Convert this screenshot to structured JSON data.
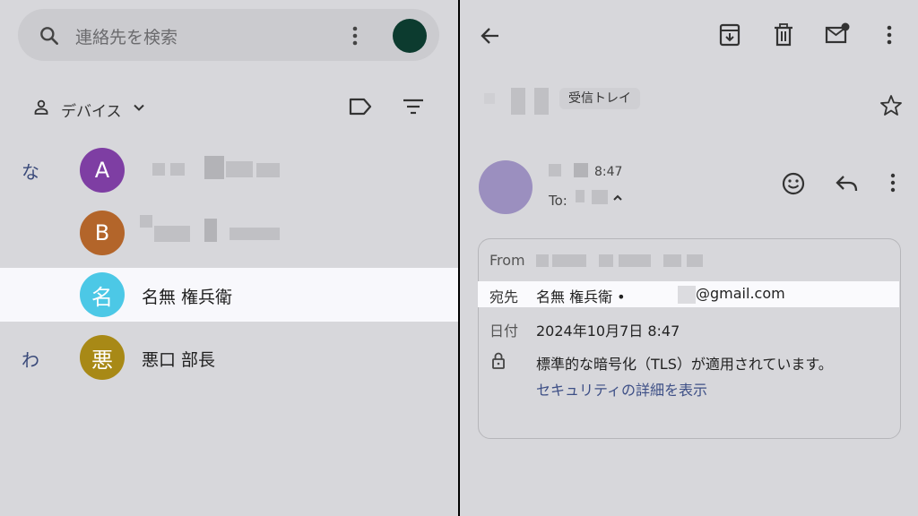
{
  "contacts_app": {
    "search_placeholder": "連絡先を検索",
    "filter_label": "デバイス",
    "sections": [
      {
        "letter": "な"
      },
      {
        "letter": "わ"
      }
    ],
    "contacts": [
      {
        "initial": "A",
        "color": "#7e3ea3"
      },
      {
        "initial": "B",
        "color": "#b3652a"
      },
      {
        "initial": "名",
        "name": "名無 権兵衛",
        "color": "#4cc8e6",
        "selected": true
      },
      {
        "initial": "悪",
        "name": "悪口 部長",
        "color": "#a88916"
      }
    ],
    "account_avatar_color": "#0c3b2f",
    "icons": [
      "search-icon",
      "more-vert-icon",
      "person-icon",
      "chevron-down-icon",
      "label-icon",
      "filter-icon"
    ]
  },
  "mail_app": {
    "inbox_label": "受信トレイ",
    "time": "8:47",
    "to_label": "To:",
    "details": {
      "from_label": "From",
      "to_row_label": "宛先",
      "to_row_value": "名無 権兵衛 •",
      "to_email_suffix": "@gmail.com",
      "date_label": "日付",
      "date_value": "2024年10月7日 8:47",
      "security_text": "標準的な暗号化（TLS）が適用されています。",
      "security_link": "セキュリティの詳細を表示"
    },
    "icons": [
      "back-arrow-icon",
      "archive-icon",
      "delete-icon",
      "mark-unread-icon",
      "more-vert-icon",
      "star-icon",
      "emoji-icon",
      "reply-icon",
      "lock-icon"
    ]
  }
}
